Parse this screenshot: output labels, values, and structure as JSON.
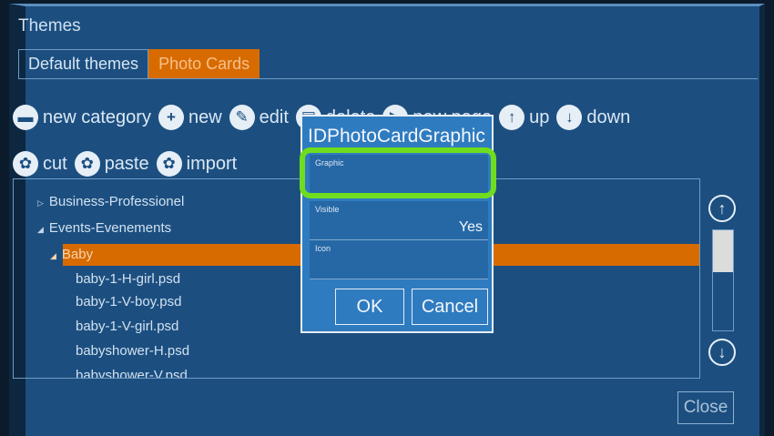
{
  "window": {
    "title": "Themes"
  },
  "tabs": [
    {
      "label": "Default themes"
    },
    {
      "label": "Photo Cards"
    }
  ],
  "toolbar": {
    "row1": [
      {
        "label": "new category",
        "icon": "folder-icon"
      },
      {
        "label": "new",
        "icon": "plus-icon"
      },
      {
        "label": "edit",
        "icon": "pencil-icon"
      },
      {
        "label": "delete",
        "icon": "trash-icon"
      },
      {
        "label": "new page",
        "icon": "arrow-right-icon"
      },
      {
        "label": "up",
        "icon": "arrow-up-icon"
      },
      {
        "label": "down",
        "icon": "arrow-down-icon"
      }
    ],
    "row2": [
      {
        "label": "cut",
        "icon": "gear-icon"
      },
      {
        "label": "paste",
        "icon": "gear-icon"
      },
      {
        "label": "import",
        "icon": "gear-icon"
      }
    ]
  },
  "tree": {
    "items": [
      {
        "label": "Business-Professionel",
        "expanded": false
      },
      {
        "label": "Events-Evenements",
        "expanded": true
      },
      {
        "label": "Baby",
        "expanded": true,
        "selected": true
      },
      {
        "label": "baby-1-H-girl.psd"
      },
      {
        "label": "baby-1-V-boy.psd"
      },
      {
        "label": "baby-1-V-girl.psd"
      },
      {
        "label": "babyshower-H.psd"
      },
      {
        "label": "babyshower-V.psd"
      }
    ]
  },
  "scroll": {
    "up_icon": "arrow-up-icon",
    "down_icon": "arrow-down-icon"
  },
  "close_label": "Close",
  "dialog": {
    "title": "IDPhotoCardGraphic",
    "fields": [
      {
        "label": "Graphic",
        "value": ""
      },
      {
        "label": "Visible",
        "value": "Yes"
      },
      {
        "label": "Icon",
        "value": ""
      }
    ],
    "ok_label": "OK",
    "cancel_label": "Cancel"
  },
  "colors": {
    "accent": "#d86b00",
    "highlight": "#6fdd1e",
    "panel": "#1c4f80",
    "dialog": "#2f7bc0"
  }
}
